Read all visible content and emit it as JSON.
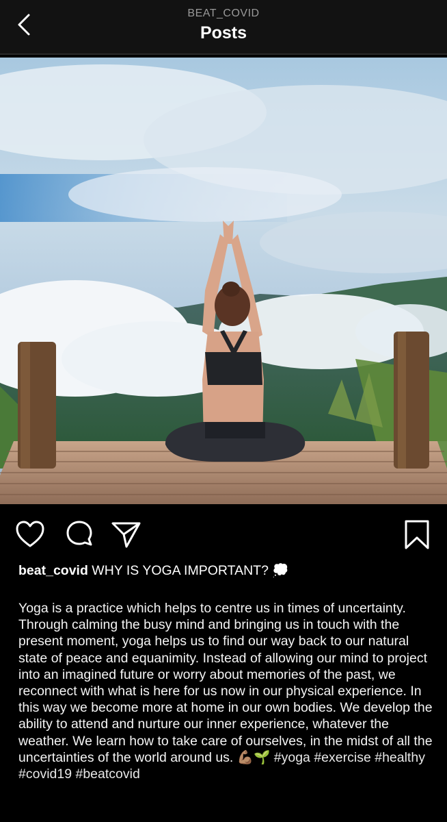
{
  "header": {
    "username": "BEAT_COVID",
    "title": "Posts",
    "back_icon": "chevron-left-icon"
  },
  "post": {
    "image_description_icon": "post-photo",
    "actions": {
      "like_icon": "heart-icon",
      "comment_icon": "comment-icon",
      "share_icon": "paper-plane-icon",
      "save_icon": "bookmark-icon"
    },
    "caption": {
      "username": "beat_covid",
      "headline": "WHY IS YOGA IMPORTANT?",
      "headline_emoji": "💭",
      "body": "Yoga is a practice which helps to centre us in times of uncertainty. Through calming the busy mind and bringing us in touch with the present moment, yoga helps us to find our way back to our natural state of peace and equanimity. Instead of allowing our mind to project into an imagined future or worry about memories of the past, we reconnect with what is here for us now in our physical experience. In this way we become more at home in our own bodies. We develop the ability to attend and nurture our inner experience, whatever the weather. We learn how to take care of ourselves, in the midst of all the uncertainties of the world around us.",
      "body_emoji": "💪🏽🌱",
      "hashtags": [
        "#yoga",
        "#exercise",
        "#healthy",
        "#covid19",
        "#beatcovid"
      ]
    }
  },
  "colors": {
    "background": "#000000",
    "header_bg": "#121212",
    "text": "#ffffff",
    "muted": "#9a9a9a"
  }
}
